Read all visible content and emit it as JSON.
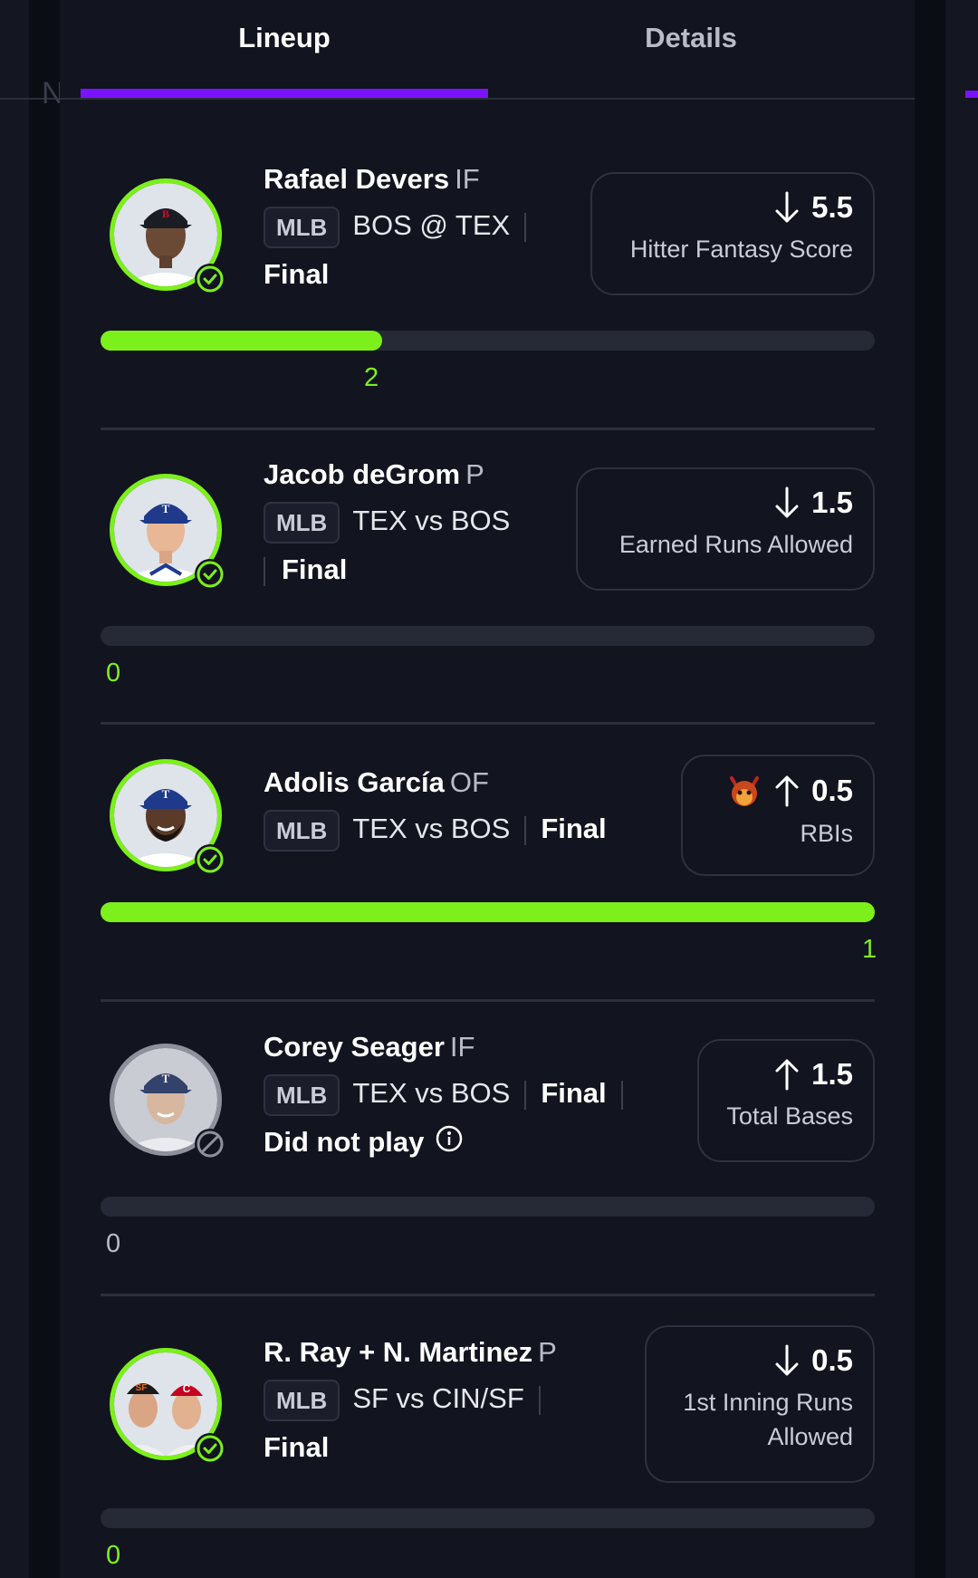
{
  "tabs": [
    {
      "label": "Lineup",
      "active": true
    },
    {
      "label": "Details",
      "active": false
    }
  ],
  "colors": {
    "accent": "#7b12ff",
    "progress": "#7cf01a",
    "background": "#12141f"
  },
  "picks": [
    {
      "player": "Rafael Devers",
      "position": "IF",
      "league": "MLB",
      "matchup": "BOS @ TEX",
      "status": "Final",
      "note": "",
      "direction": "down",
      "line": "5.5",
      "stat": "Hitter Fantasy Score",
      "progress_value": "2",
      "progress_fraction": 0.364,
      "played": true
    },
    {
      "player": "Jacob deGrom",
      "position": "P",
      "league": "MLB",
      "matchup": "TEX vs BOS",
      "status": "Final",
      "note": "",
      "direction": "down",
      "line": "1.5",
      "stat": "Earned Runs Allowed",
      "progress_value": "0",
      "progress_fraction": 0,
      "played": true
    },
    {
      "player": "Adolis García",
      "position": "OF",
      "league": "MLB",
      "matchup": "TEX vs BOS",
      "status": "Final",
      "note": "",
      "direction": "up",
      "line": "0.5",
      "stat": "RBIs",
      "badge_icon": "demon-icon",
      "progress_value": "1",
      "progress_fraction": 1,
      "played": true
    },
    {
      "player": "Corey Seager",
      "position": "IF",
      "league": "MLB",
      "matchup": "TEX vs BOS",
      "status": "Final",
      "note": "Did not play",
      "direction": "up",
      "line": "1.5",
      "stat": "Total Bases",
      "progress_value": "0",
      "progress_fraction": 0,
      "played": false
    },
    {
      "player": "R. Ray + N. Martinez",
      "position": "P",
      "league": "MLB",
      "matchup": "SF vs CIN/SF",
      "status": "Final",
      "note": "",
      "direction": "down",
      "line": "0.5",
      "stat_line1": "1st Inning Runs",
      "stat_line2": "Allowed",
      "progress_value": "0",
      "progress_fraction": 0,
      "played": true
    }
  ]
}
